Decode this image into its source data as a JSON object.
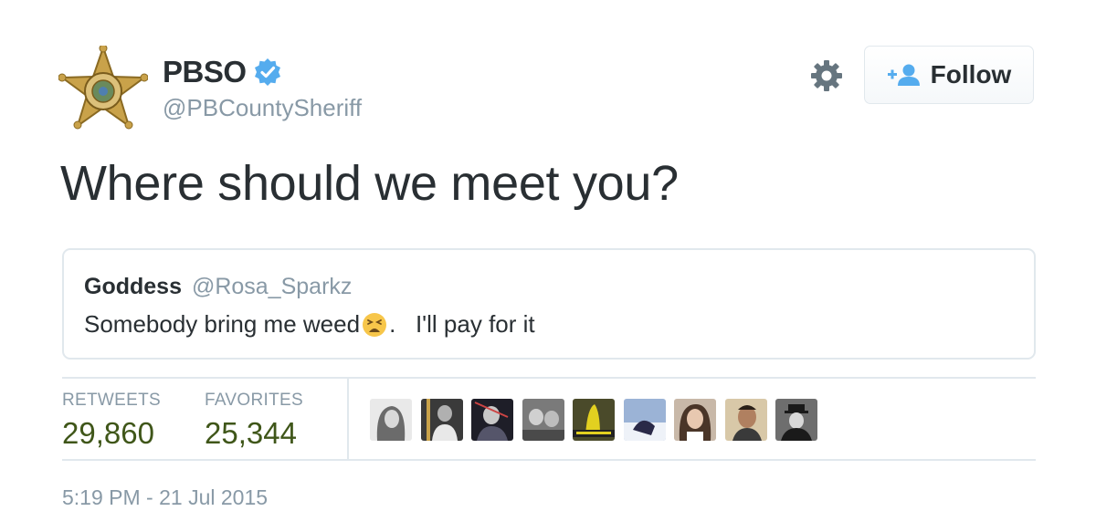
{
  "author": {
    "name": "PBSO",
    "handle": "@PBCountySheriff",
    "avatar_icon": "sheriff-star-badge-icon",
    "verified_icon": "verified-badge-icon",
    "verified_color": "#55acee"
  },
  "actions": {
    "settings_icon": "gear-icon",
    "follow_label": "Follow",
    "follow_icon": "add-user-icon"
  },
  "tweet": {
    "text": "Where should we meet you?"
  },
  "quoted": {
    "name": "Goddess",
    "handle": "@Rosa_Sparkz",
    "text_before": "Somebody bring me weed",
    "emoji_icon": "weary-face-emoji",
    "text_after": ".   I'll pay for it"
  },
  "stats": {
    "retweets_label": "RETWEETS",
    "retweets_value": "29,860",
    "favorites_label": "FAVORITES",
    "favorites_value": "25,344",
    "value_color": "#3f5619"
  },
  "favoriters": [
    {
      "icon": "user-avatar-1"
    },
    {
      "icon": "user-avatar-2"
    },
    {
      "icon": "user-avatar-3"
    },
    {
      "icon": "user-avatar-4"
    },
    {
      "icon": "user-avatar-5"
    },
    {
      "icon": "user-avatar-6"
    },
    {
      "icon": "user-avatar-7"
    },
    {
      "icon": "user-avatar-8"
    },
    {
      "icon": "user-avatar-9"
    }
  ],
  "timestamp": "5:19 PM - 21 Jul 2015"
}
